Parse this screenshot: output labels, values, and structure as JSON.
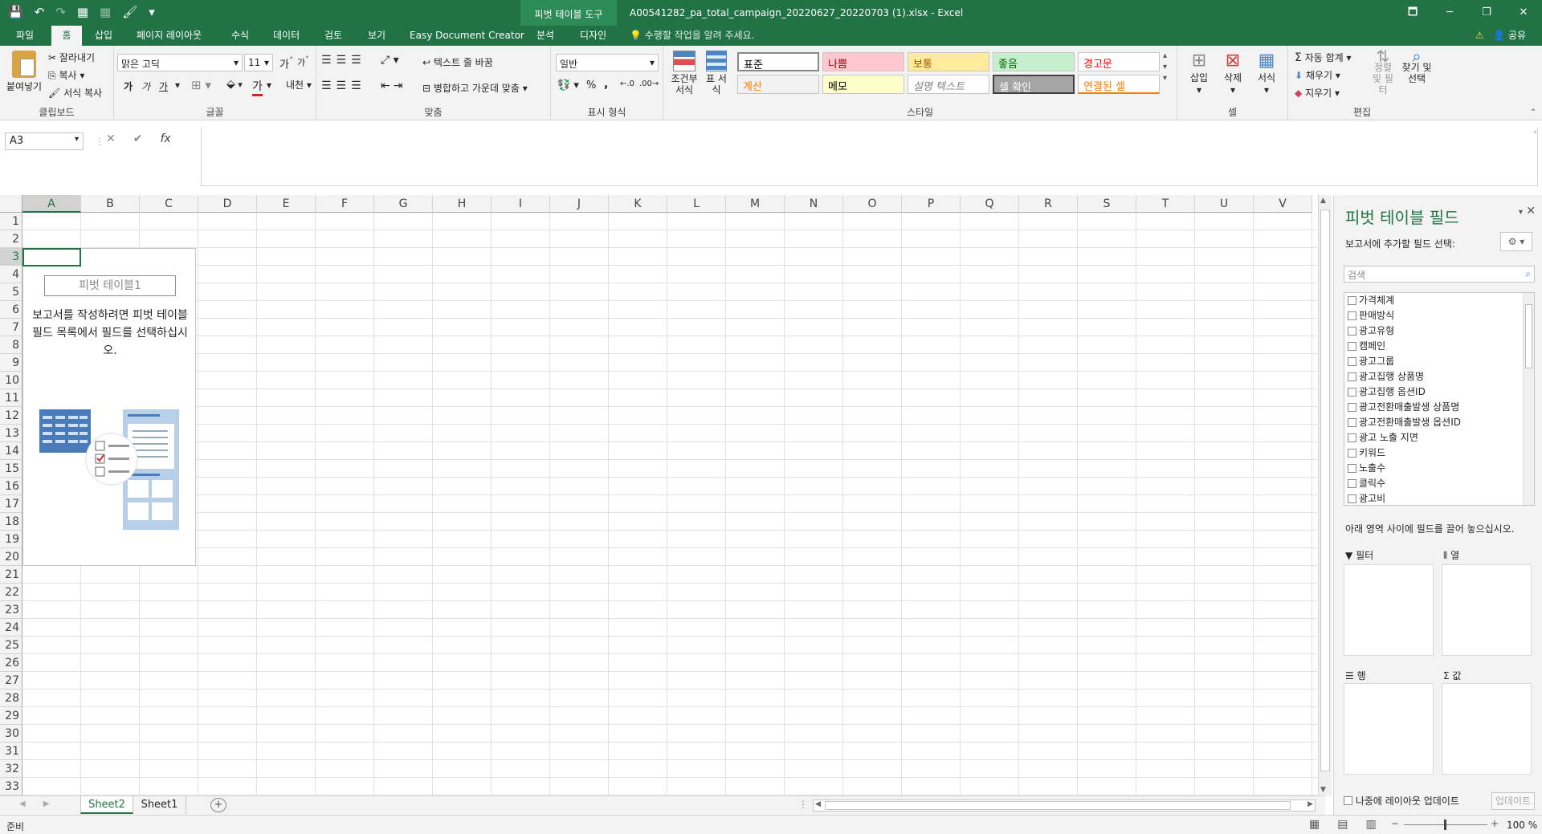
{
  "window": {
    "title": "A00541282_pa_total_campaign_20220627_20220703 (1).xlsx  -  Excel",
    "context_tab_group": "피벗 테이블 도구",
    "controls": [
      "🗖",
      "─",
      "❐",
      "✕"
    ]
  },
  "qat": {
    "save": "💾",
    "undo": "↶",
    "redo": "↷",
    "t1": "▦",
    "t2": "▦",
    "t3": "🖌",
    "more": "▾"
  },
  "tabs": [
    "파일",
    "홈",
    "삽입",
    "페이지 레이아웃",
    "수식",
    "데이터",
    "검토",
    "보기",
    "Easy Document Creator",
    "분석",
    "디자인"
  ],
  "active_tab": "홈",
  "tell_me": "수행할 작업을 알려 주세요.",
  "share": "공유",
  "ribbon": {
    "clipboard": {
      "paste": "붙여넣기",
      "cut": "잘라내기",
      "copy": "복사",
      "format_painter": "서식 복사",
      "label": "클립보드"
    },
    "font": {
      "name": "맑은 고딕",
      "size": "11",
      "grow": "가",
      "shrink": "가",
      "bold": "가",
      "italic": "가",
      "underline": "가",
      "label": "글꼴"
    },
    "alignment": {
      "wrap": "텍스트 줄 바꿈",
      "merge": "병합하고 가운데 맞춤",
      "label": "맞춤"
    },
    "number": {
      "format": "일반",
      "percent": "%",
      "comma": ",",
      "label": "표시 형식"
    },
    "styles": {
      "conditional": "조건부 서식",
      "table": "표 서식",
      "cells": [
        {
          "label": "표준",
          "bg": "#ffffff",
          "fg": "#000000"
        },
        {
          "label": "나쁨",
          "bg": "#ffc7ce",
          "fg": "#9c0006"
        },
        {
          "label": "보통",
          "bg": "#ffeb9c",
          "fg": "#9c5700"
        },
        {
          "label": "좋음",
          "bg": "#c6efce",
          "fg": "#006100"
        },
        {
          "label": "경고문",
          "bg": "#ffffff",
          "fg": "#ff0000"
        },
        {
          "label": "계산",
          "bg": "#f2f2f2",
          "fg": "#fa7d00"
        },
        {
          "label": "메모",
          "bg": "#ffffcc",
          "fg": "#000000"
        },
        {
          "label": "설명 텍스트",
          "bg": "#ffffff",
          "fg": "#7f7f7f"
        },
        {
          "label": "셀 확인",
          "bg": "#a5a5a5",
          "fg": "#ffffff"
        },
        {
          "label": "연결된 셀",
          "bg": "#ffffff",
          "fg": "#fa7d00"
        }
      ],
      "label": "스타일"
    },
    "cells": {
      "insert": "삽입",
      "delete": "삭제",
      "format": "서식",
      "label": "셀"
    },
    "editing": {
      "autosum": "자동 합계",
      "fill": "채우기",
      "clear": "지우기",
      "sort": "정렬 및 필터",
      "find": "찾기 및 선택",
      "label": "편집"
    }
  },
  "formula_bar": {
    "name_box": "A3",
    "cancel": "✕",
    "enter": "✔",
    "fx": "fx",
    "value": ""
  },
  "grid": {
    "columns": [
      "A",
      "B",
      "C",
      "D",
      "E",
      "F",
      "G",
      "H",
      "I",
      "J",
      "K",
      "L",
      "M",
      "N",
      "O",
      "P",
      "Q",
      "R",
      "S",
      "T",
      "U",
      "V"
    ],
    "rows": [
      "1",
      "2",
      "3",
      "4",
      "5",
      "6",
      "7",
      "8",
      "9",
      "10",
      "11",
      "12",
      "13",
      "14",
      "15",
      "16",
      "17",
      "18",
      "19",
      "20",
      "21",
      "22",
      "23",
      "24",
      "25",
      "26",
      "27",
      "28",
      "29",
      "30",
      "31",
      "32",
      "33"
    ],
    "active_col": "A",
    "active_row": "3"
  },
  "pivot_placeholder": {
    "name": "피벗 테이블1",
    "message": "보고서를 작성하려면 피벗 테이블 필드 목록에서 필드를 선택하십시오."
  },
  "sheets": {
    "tabs": [
      "Sheet2",
      "Sheet1"
    ],
    "active": "Sheet2",
    "add": "+"
  },
  "status": {
    "ready": "준비",
    "zoom": "100 %"
  },
  "pivot_pane": {
    "title": "피벗 테이블 필드",
    "subtitle": "보고서에 추가할 필드 선택:",
    "search_placeholder": "검색",
    "fields": [
      "가격체계",
      "판매방식",
      "광고유형",
      "캠페인",
      "광고그룹",
      "광고집행 상품명",
      "광고집행 옵션ID",
      "광고전환매출발생 상품명",
      "광고전환매출발생 옵션ID",
      "광고 노출 지면",
      "키워드",
      "노출수",
      "클릭수",
      "광고비"
    ],
    "areas_hint": "아래 영역 사이에 필드를 끌어 놓으십시오.",
    "areas": {
      "filter": "필터",
      "columns": "열",
      "rows": "행",
      "values": "값"
    },
    "defer": "나중에 레이아웃 업데이트",
    "update": "업데이트"
  }
}
